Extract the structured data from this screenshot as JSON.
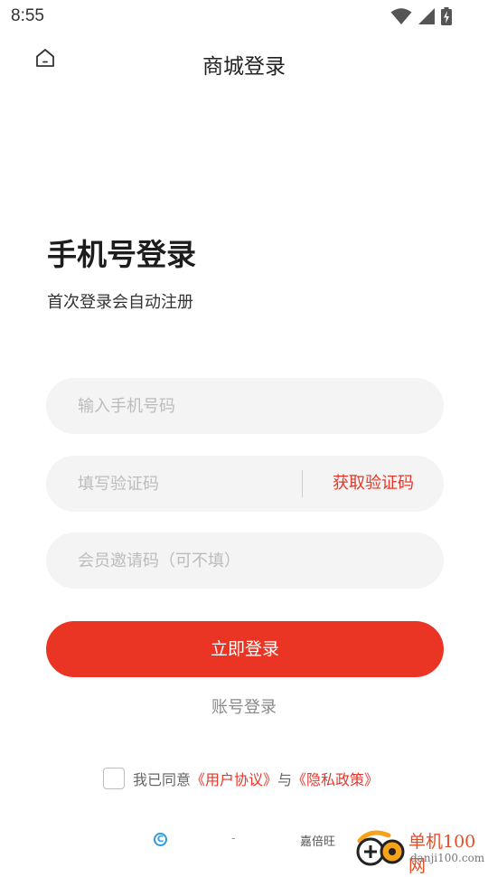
{
  "status_bar": {
    "time": "8:55",
    "icons": [
      "wifi-icon",
      "signal-icon",
      "battery-charging-icon"
    ]
  },
  "header": {
    "title": "商城登录",
    "home_icon": "home-icon"
  },
  "main": {
    "title": "手机号登录",
    "subtitle": "首次登录会自动注册"
  },
  "form": {
    "phone_placeholder": "输入手机号码",
    "code_placeholder": "填写验证码",
    "get_code_label": "获取验证码",
    "invite_placeholder": "会员邀请码（可不填）",
    "submit_label": "立即登录",
    "account_login_label": "账号登录"
  },
  "agreement": {
    "prefix": "我已同意",
    "user_agreement": "《用户协议》",
    "joiner": "与",
    "privacy_policy": "《隐私政策》",
    "checked": false
  },
  "footer": {
    "copyright_symbol": "C",
    "separator": "-",
    "company": "嘉倍旺"
  },
  "watermark": {
    "text": "单机100网",
    "url": "danji100.com"
  },
  "colors": {
    "accent": "#ea3524",
    "field_bg": "#f4f4f4",
    "placeholder": "#bcbcbc"
  }
}
